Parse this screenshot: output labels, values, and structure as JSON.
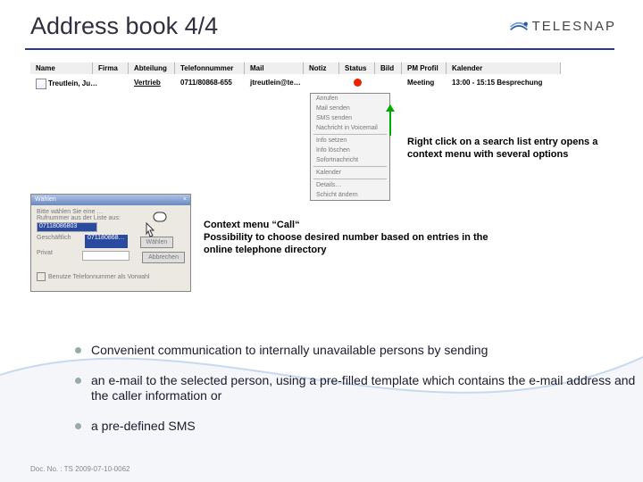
{
  "title": "Address book 4/4",
  "logo_text": "TELESNAP",
  "table": {
    "headers": [
      "Name",
      "Firma",
      "Abteilung",
      "Telefonnummer",
      "Mail",
      "Notiz",
      "Status",
      "Bild",
      "PM Profil",
      "Kalender"
    ],
    "row": {
      "name": "Treutlein, Ju…",
      "firma": "",
      "abteilung": "Vertrieb",
      "telefon": "0711/80868-655",
      "mail": "jtreutlein@te…",
      "notiz": "",
      "status_color": "#e02000",
      "bild": "",
      "pm_profil": "Meeting",
      "kalender": "13:00 - 15:15 Besprechung"
    }
  },
  "context_menu": {
    "items": [
      "Anrufen",
      "Mail senden",
      "SMS senden",
      "Nachricht in Voicemail",
      "Info setzen",
      "Info löschen",
      "Sofortnachricht",
      "Kalender",
      "Details…",
      "Schicht ändern"
    ]
  },
  "caption_right": "Right click on a search list entry opens a context menu with several options",
  "caption_dialog": "Context menu  “Call“\nPossibility to choose desired number based on entries in the online telephone directory",
  "dialog": {
    "title": "Wählen",
    "close": "×",
    "hint1": "Bitte wählen Sie eine …",
    "hint2": "Rufnummer aus der Liste aus:",
    "field_label1": "Geschäftlich",
    "field_value1": "07118086803",
    "field_label2": "Geschäftlich",
    "field_value2": "071180868…",
    "field_label3": "Privat",
    "btn_dial": "Wählen",
    "btn_cancel": "Abbrechen",
    "checkbox": "Benutze Telefonnummer als Vorwahl"
  },
  "bullets": [
    "Convenient communication to internally unavailable persons by sending",
    "an e-mail to the selected person, using a pre-filled template which contains the e-mail address and the caller information or",
    "a pre-defined SMS"
  ],
  "footer": "Doc. No. : TS 2009-07-10-0062"
}
